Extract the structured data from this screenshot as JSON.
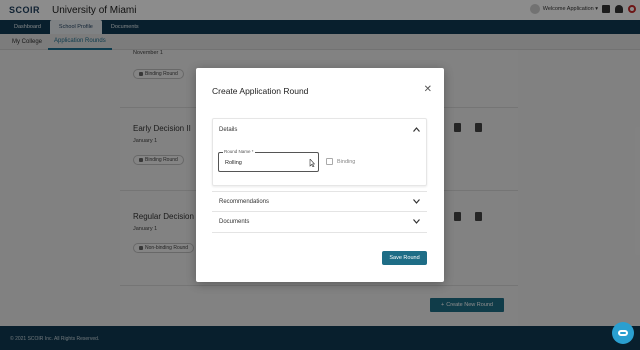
{
  "header": {
    "brand": "SCOIR",
    "college_name": "University of Miami",
    "welcome": "Welcome Application ▾"
  },
  "nav": {
    "tabs": [
      {
        "label": "Dashboard"
      },
      {
        "label": "School Profile"
      },
      {
        "label": "Documents"
      }
    ]
  },
  "subnav": {
    "tabs": [
      {
        "label": "My College"
      },
      {
        "label": "Application Rounds"
      }
    ]
  },
  "rounds": [
    {
      "title": "",
      "date": "November 1",
      "badge": "Binding Round"
    },
    {
      "title": "Early Decision II",
      "date": "January 1",
      "badge": "Binding Round"
    },
    {
      "title": "Regular Decision",
      "date": "January 1",
      "badge": "Non-binding Round"
    }
  ],
  "actions": {
    "create_round": "Create New Round",
    "create_icon": "+"
  },
  "footer": {
    "copyright": "© 2021 SCOIR Inc. All Rights Reserved."
  },
  "modal": {
    "title": "Create Application Round",
    "close_glyph": "✕",
    "details_label": "Details",
    "round_name_label": "Round Name *",
    "round_name_value": "Rolling",
    "binding_label": "Binding",
    "recommendations_label": "Recommendations",
    "documents_label": "Documents",
    "save_label": "Save Round",
    "chevron_up": "Ⲅ",
    "chevron_down": "⌄"
  },
  "colors": {
    "primary": "#1e6d86",
    "nav_bg": "#0f3a52",
    "help_bubble": "#2a9fd0"
  }
}
